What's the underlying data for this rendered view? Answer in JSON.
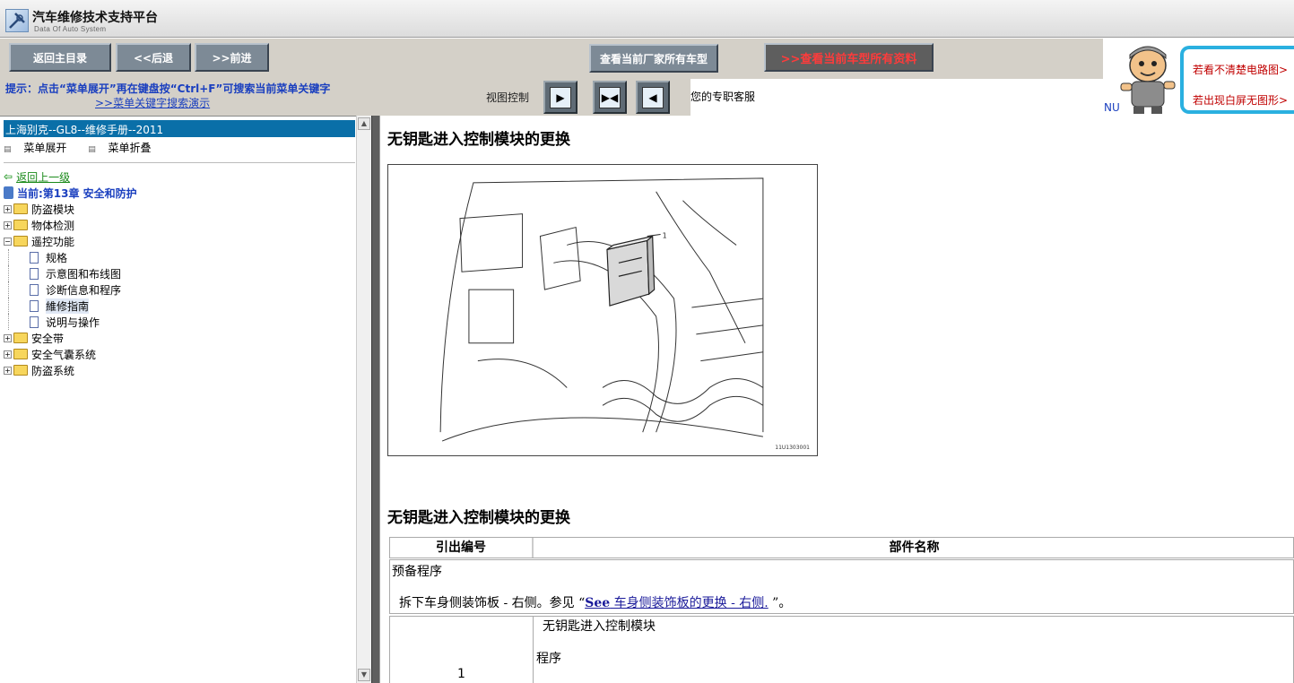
{
  "app": {
    "title": "汽车维修技术支持平台",
    "subtitle": "Data Of Auto System"
  },
  "toolbar": {
    "back_to_main": "返回主目录",
    "back": "<<后退",
    "forward": ">>前进",
    "view_all_models": "查看当前厂家所有车型",
    "view_all_docs": ">>查看当前车型所有资料"
  },
  "hint": {
    "line1": "提示：点击“菜单展开”再在键盘按“Ctrl+F”可搜索当前菜单关键字",
    "line2": ">>菜单关键字搜索演示",
    "view_control_label": "视图控制",
    "service_text": "您的专职客服"
  },
  "promo": {
    "line1": "若看不清楚电路图>",
    "line2": "若出现白屏无图形>",
    "nu": "NU"
  },
  "sidebar": {
    "title": "上海别克--GL8--维修手册--2011",
    "expand": "菜单展开",
    "collapse": "菜单折叠",
    "back_up": "返回上一级",
    "current": "当前:第13章 安全和防护",
    "items": [
      {
        "label": "防盗模块",
        "level": 0,
        "type": "folder",
        "expanded": false
      },
      {
        "label": "物体检测",
        "level": 0,
        "type": "folder",
        "expanded": false
      },
      {
        "label": "遥控功能",
        "level": 0,
        "type": "folder",
        "expanded": true
      },
      {
        "label": "规格",
        "level": 1,
        "type": "doc"
      },
      {
        "label": "示意图和布线图",
        "level": 1,
        "type": "doc"
      },
      {
        "label": "诊断信息和程序",
        "level": 1,
        "type": "doc"
      },
      {
        "label": "維修指南",
        "level": 1,
        "type": "doc",
        "selected": true
      },
      {
        "label": "说明与操作",
        "level": 1,
        "type": "doc"
      },
      {
        "label": "安全带",
        "level": 0,
        "type": "folder",
        "expanded": false
      },
      {
        "label": "安全气囊系统",
        "level": 0,
        "type": "folder",
        "expanded": false
      },
      {
        "label": "防盗系统",
        "level": 0,
        "type": "folder",
        "expanded": false
      }
    ]
  },
  "content": {
    "heading": "无钥匙进入控制模块的更换",
    "figure_number": "11U1303001",
    "figure_callout": "1",
    "heading2": "无钥匙进入控制模块的更换",
    "table": {
      "col1": "引出编号",
      "col2": "部件名称",
      "prep_title": "预备程序",
      "prep_text_before": "拆下车身侧装饰板 - 右侧。参见 “",
      "prep_link_see": "See",
      "prep_link_text": " 车身侧装饰板的更换 - 右侧.",
      "prep_text_after": " ”。",
      "row1_num": "1",
      "row1_name": "无钥匙进入控制模块",
      "row1_proc": "程序"
    }
  }
}
